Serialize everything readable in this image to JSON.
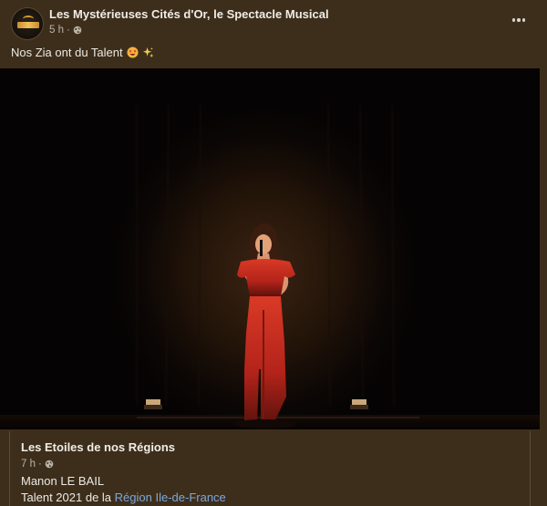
{
  "post": {
    "page_name": "Les Mystérieuses Cités d'Or, le Spectacle Musical",
    "time": "5 h",
    "time_separator": "·",
    "caption": "Nos Zia ont du Talent",
    "emojis": [
      "star-struck-emoji",
      "sparkles-emoji"
    ],
    "more_icon": "more-options-icon",
    "audience_icon": "globe-icon"
  },
  "photo": {
    "subject": "singer-in-red-jumpsuit-on-stage"
  },
  "shared": {
    "page_name": "Les Etoiles de nos Régions",
    "time": "7 h",
    "time_separator": "·",
    "line1": "Manon LE BAIL",
    "line2_prefix": "Talent 2021 de la",
    "line2_link": "Région Ile-de-France"
  },
  "colors": {
    "background": "#3d2e1c",
    "text": "#ece9e2",
    "muted": "#b9b3a6",
    "link": "#7da7d9",
    "dress": "#c8281e"
  }
}
